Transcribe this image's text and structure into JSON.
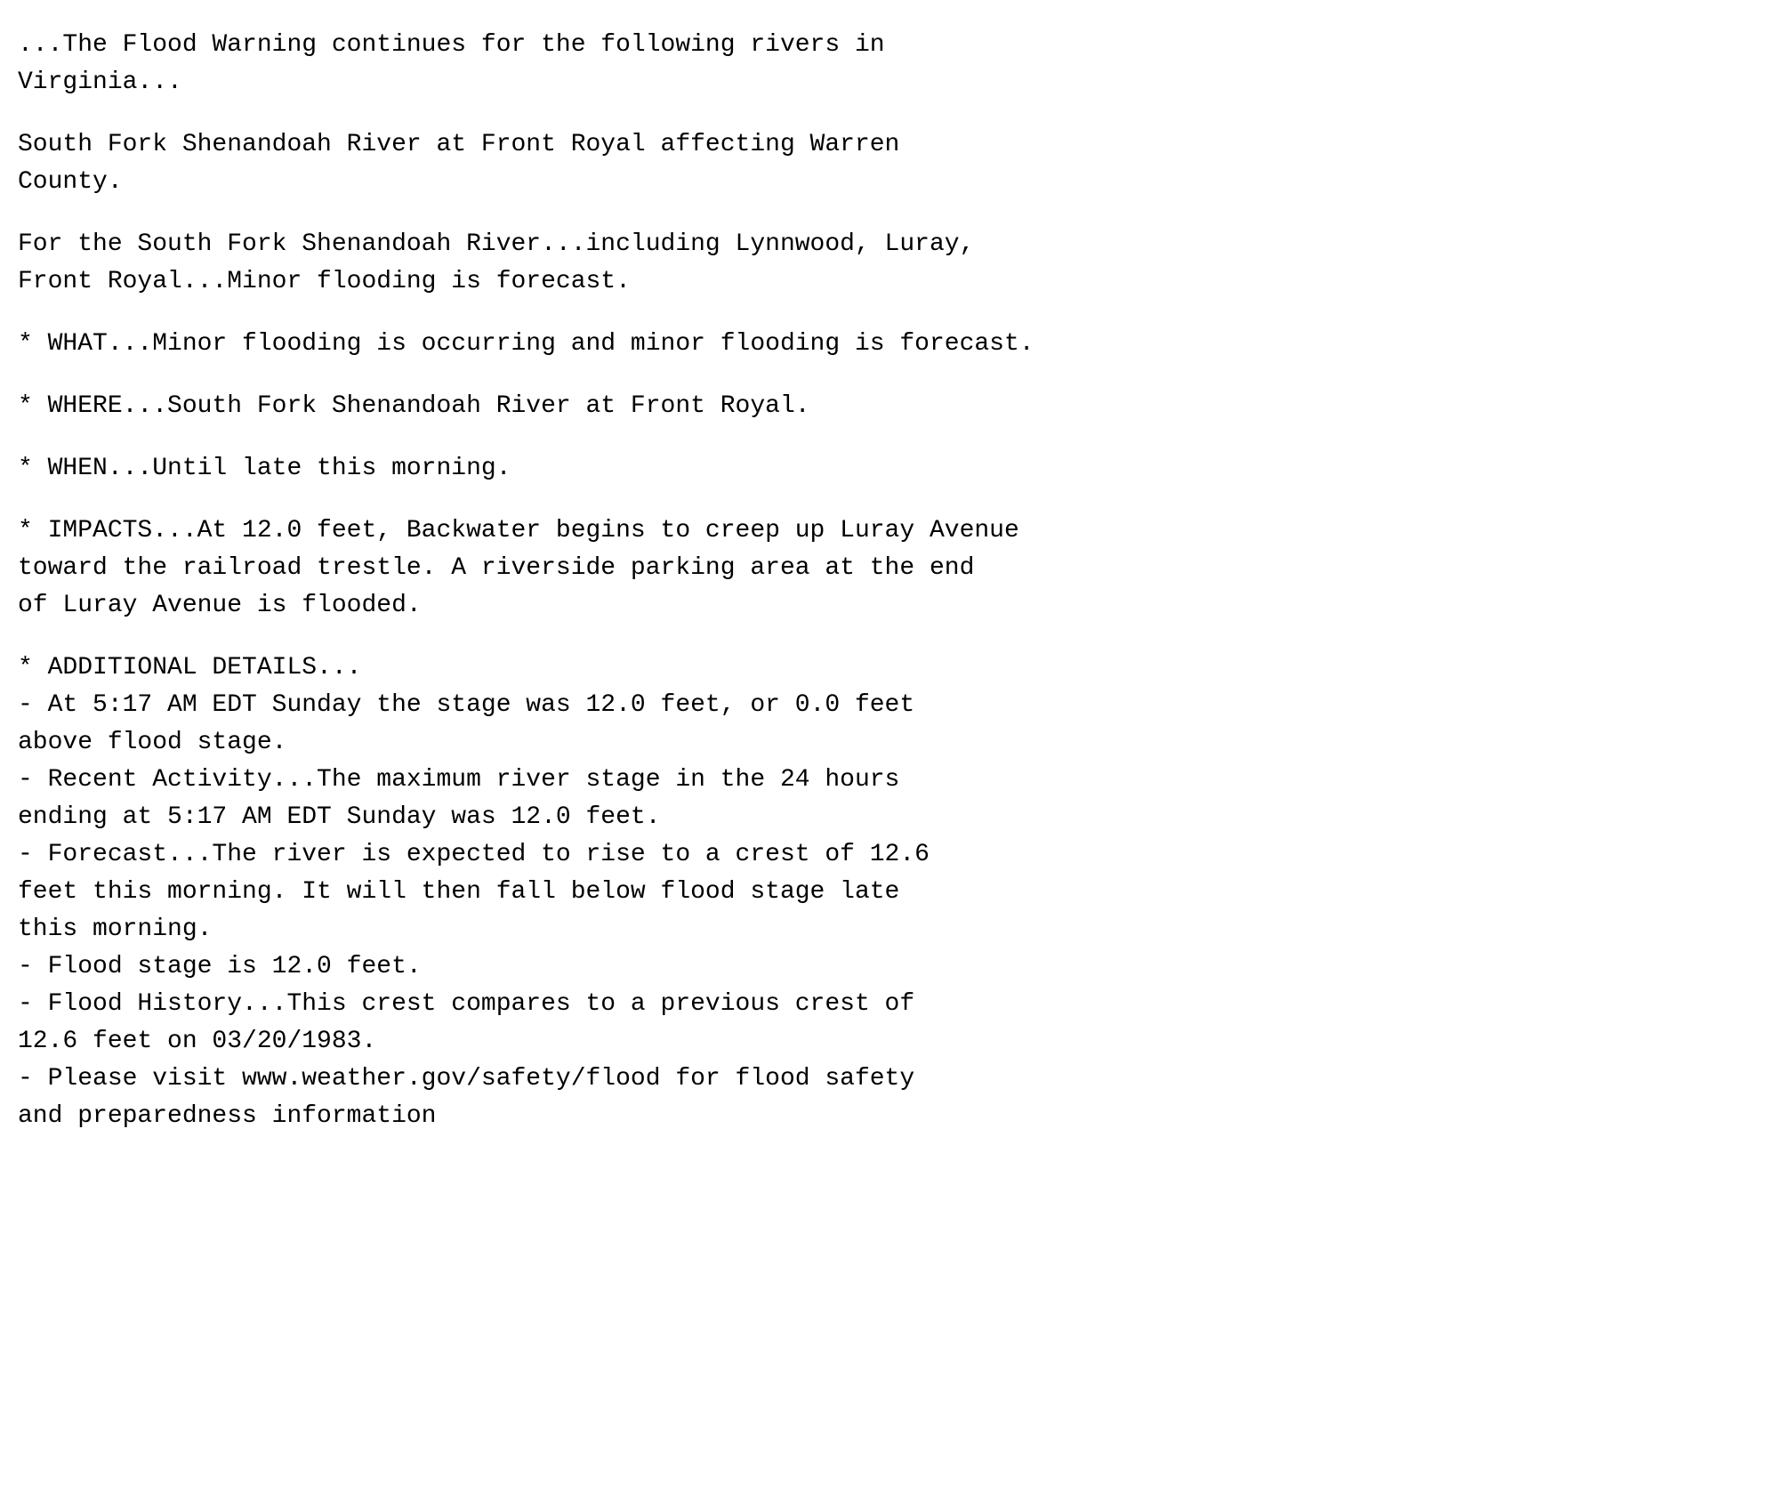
{
  "content": {
    "paragraphs": [
      {
        "id": "intro",
        "text": "...The Flood Warning continues for the following rivers in\nVirginia..."
      },
      {
        "id": "location",
        "text": "South Fork Shenandoah River at Front Royal affecting Warren\nCounty."
      },
      {
        "id": "forecast-summary",
        "text": "For the South Fork Shenandoah River...including Lynnwood, Luray,\nFront Royal...Minor flooding is forecast."
      },
      {
        "id": "what",
        "text": "* WHAT...Minor flooding is occurring and minor flooding is forecast."
      },
      {
        "id": "where",
        "text": "* WHERE...South Fork Shenandoah River at Front Royal."
      },
      {
        "id": "when",
        "text": "* WHEN...Until late this morning."
      },
      {
        "id": "impacts",
        "text": "* IMPACTS...At 12.0 feet, Backwater begins to creep up Luray Avenue\ntoward the railroad trestle. A riverside parking area at the end\nof Luray Avenue is flooded."
      },
      {
        "id": "additional-details",
        "text": "* ADDITIONAL DETAILS...\n- At 5:17 AM EDT Sunday the stage was 12.0 feet, or 0.0 feet\nabove flood stage.\n- Recent Activity...The maximum river stage in the 24 hours\nending at 5:17 AM EDT Sunday was 12.0 feet.\n- Forecast...The river is expected to rise to a crest of 12.6\nfeet this morning. It will then fall below flood stage late\nthis morning.\n- Flood stage is 12.0 feet.\n- Flood History...This crest compares to a previous crest of\n12.6 feet on 03/20/1983.\n- Please visit www.weather.gov/safety/flood for flood safety\nand preparedness information"
      }
    ]
  }
}
